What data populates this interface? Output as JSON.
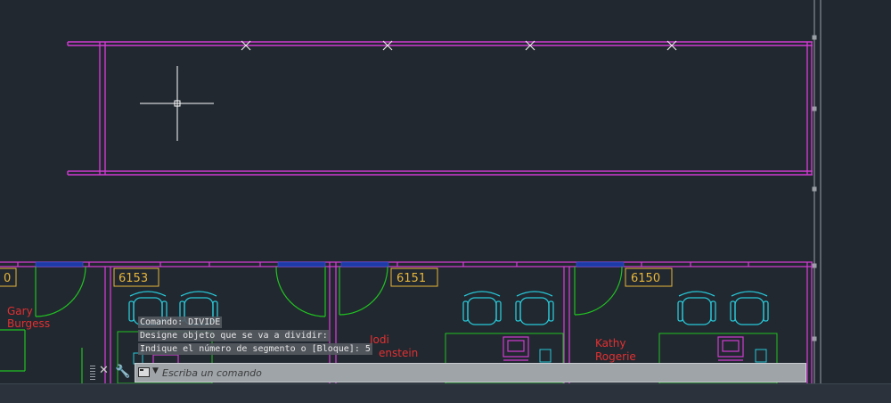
{
  "colors": {
    "background": "#212830",
    "walls": "#d13bd1",
    "doors": "#21c221",
    "furniture": "#28c8d8",
    "tags": "#e8b63a",
    "names": "#e23030",
    "windows": "#1e3aa8",
    "crosshair": "#ffffff"
  },
  "drawing": {
    "room_tags": [
      "0",
      "6153",
      "6151",
      "6150"
    ],
    "occupants": [
      {
        "line1": "Gary",
        "line2": "Burgess"
      },
      {
        "line1": "Jodi",
        "line2": "enstein"
      },
      {
        "line1": "Kathy",
        "line2": "Rogerie"
      }
    ],
    "divide_markers": [
      "x",
      "x",
      "x",
      "x"
    ]
  },
  "command_history": [
    "Comando: DIVIDE",
    "Designe objeto que se va a dividir:",
    "Indique el número de segmento o [Bloque]: 5"
  ],
  "command_line": {
    "placeholder": "Escriba un comando",
    "value": ""
  },
  "icons": {
    "grip": "grip-icon",
    "close": "close-icon",
    "customize": "wrench-icon",
    "prompt": "command-prompt-icon",
    "caret": "caret-down-icon"
  }
}
